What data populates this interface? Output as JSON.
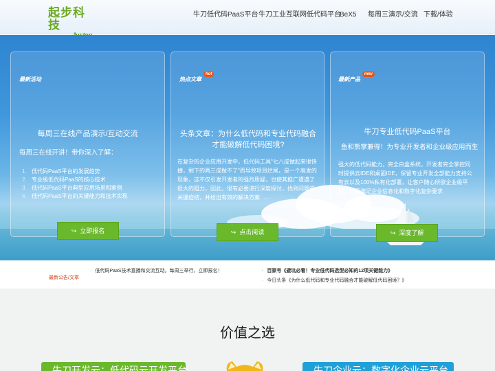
{
  "logo": {
    "cn": "起步科技",
    "en": "Justep"
  },
  "nav": [
    {
      "label": "牛刀低代码PaaS平台"
    },
    {
      "label": "牛刀工业互联网低代码平台"
    },
    {
      "label": "BeX5"
    },
    {
      "label": "每周三演示/交流"
    },
    {
      "label": "下载/体验"
    }
  ],
  "panels": [
    {
      "tag": "最新活动",
      "title": "每周三在线产品演示/互动交流",
      "subtitle": "每周三在线开讲！带你深入了解：",
      "items": [
        {
          "num": "1.",
          "text": "低代码PaaS平台的发展趋势"
        },
        {
          "num": "2.",
          "text": "专业级低代码PaaS的核心技术"
        },
        {
          "num": "3.",
          "text": "低代码PaaS平台典型应用场景和案例"
        },
        {
          "num": "4.",
          "text": "低代码PaaS平台的关键能力和技术实现"
        }
      ],
      "button": "立即报名"
    },
    {
      "tag": "热点文章",
      "badge": "hot",
      "title": "头条文章：为什么低代码和专业代码融合才能破解低代码困境?",
      "body": "在复杂的企业应用开发中，低代码工具\"七八成做起来很快捷，剩下的两三成做不了\"而导致项目烂尾，是一个高发的现象，这不仅引发开发者的强烈质疑，也使其推广遭遇了很大的阻力，因此，很有必要进行深度探讨，找到问题的关键症结，并给出有效的解决方案……",
      "button": "点击阅读"
    },
    {
      "tag": "最新产品",
      "badge": "new",
      "title": "牛刀专业低代码PaaS平台",
      "subtitle": "鱼和熊掌兼得！为专业开发者和企业级应用而生",
      "body": "强大的低代码能力，完全白盒系统，开发者完全掌控同时提供云IDE和桌面IDE，保留专业开发全部能力支持公有云以及100%私有化部署，让客户随心所欲企业级平台，全面满足企业信息化和数字化复杂要求",
      "button": "深度了解"
    }
  ],
  "notice": {
    "label": "最新公告/文章",
    "items": [
      {
        "text": "低代码PaaS技术直播和交流互动。每周三举行，立即报名！"
      },
      {
        "text": "百家号《避坑必看！专业低代码选型必知的12项关键能力》"
      },
      {
        "text": "今日头条《为什么低代码和专业代码融合才能破解低代码困境？》"
      }
    ]
  },
  "value": {
    "title": "价值之选",
    "cards": [
      {
        "label": "牛刀开发云：低代码云开发平台"
      },
      {
        "label": "牛刀企业云：数字化企业云平台"
      }
    ]
  },
  "colors": {
    "brand_green": "#6ab82c",
    "sky_blue": "#3f97dc",
    "notice_red": "#d93b0f"
  },
  "icons": {
    "button_icon": "share-icon"
  }
}
